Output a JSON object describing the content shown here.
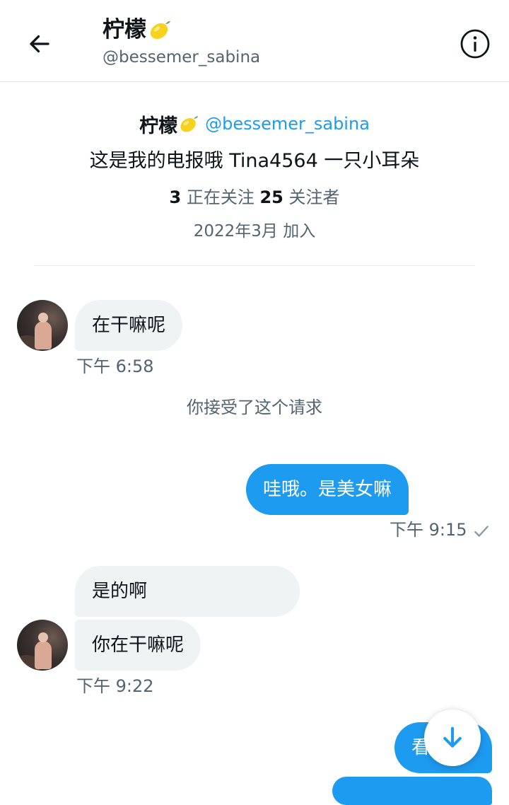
{
  "header": {
    "name": "柠檬",
    "handle": "@bessemer_sabina"
  },
  "profile": {
    "name": "柠檬",
    "handle": "@bessemer_sabina",
    "bio": "这是我的电报哦  Tina4564   一只小耳朵",
    "following_count": "3",
    "following_label": "正在关注",
    "followers_count": "25",
    "followers_label": "关注者",
    "joined": "2022年3月 加入"
  },
  "messages": [
    {
      "direction": "in",
      "text": "在干嘛呢",
      "time": "下午 6:58"
    },
    {
      "system": "你接受了这个请求"
    },
    {
      "direction": "out",
      "text": "哇哦。是美女嘛",
      "time": "下午 9:15",
      "status": "sent-check"
    },
    {
      "direction": "in",
      "text": "是的啊"
    },
    {
      "direction": "in",
      "text": "你在干嘛呢",
      "time": "下午 9:22"
    },
    {
      "direction": "out",
      "text": "看"
    }
  ],
  "colors": {
    "accent": "#1d9bf0",
    "incoming_bubble": "#eff3f4",
    "secondary_text": "#536471"
  },
  "icons": [
    "back-arrow-icon",
    "info-icon",
    "lemon-emoji-icon",
    "checkmark-icon",
    "arrow-down-icon"
  ]
}
